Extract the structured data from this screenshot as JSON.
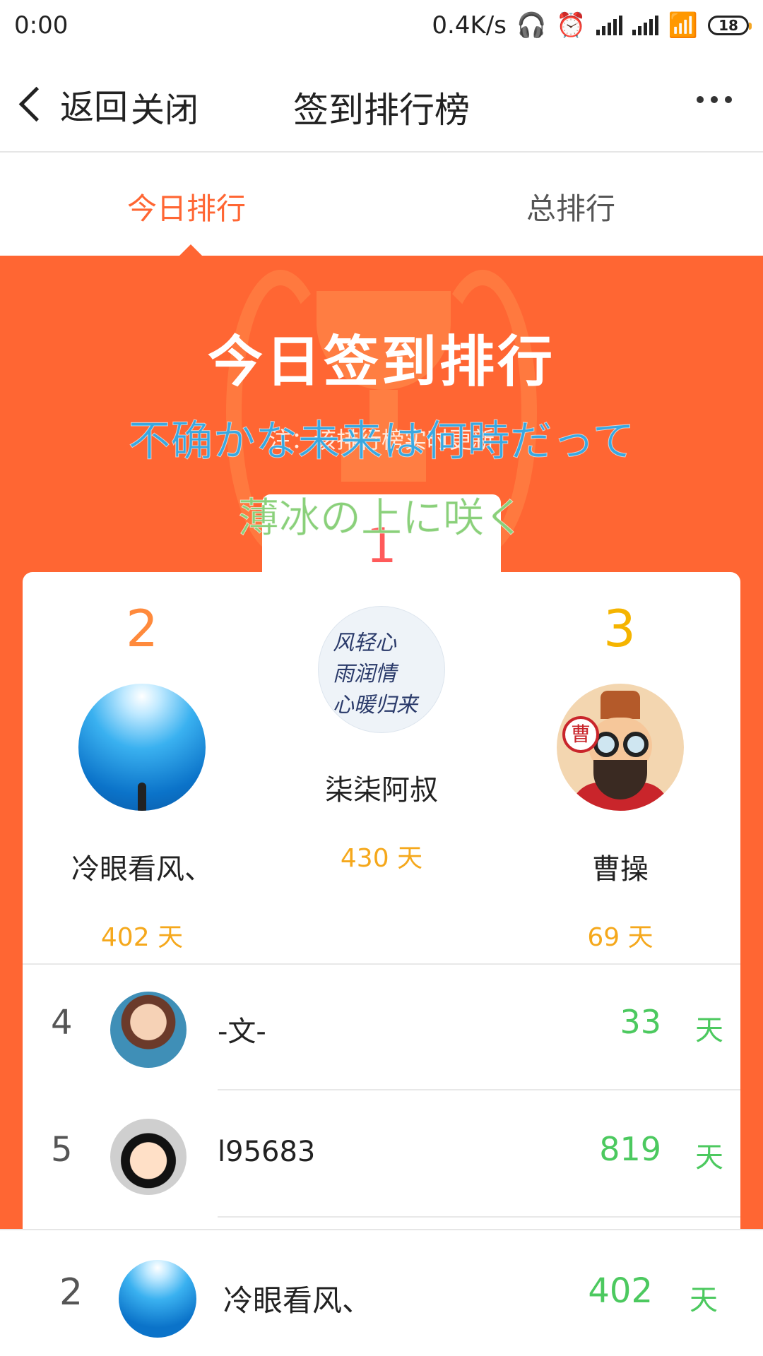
{
  "status": {
    "time": "0:00",
    "speed": "0.4K/s",
    "battery": "18",
    "icons": [
      "headphones-icon",
      "alarm-icon",
      "signal-icon",
      "signal-icon",
      "wifi-icon",
      "battery-icon"
    ]
  },
  "nav": {
    "back_label": "返回",
    "close_label": "关闭",
    "title": "签到排行榜",
    "more_icon": "more-dots-icon"
  },
  "tabs": [
    {
      "label": "今日排行",
      "active": true
    },
    {
      "label": "总排行",
      "active": false
    }
  ],
  "hero": {
    "title": "今日签到排行",
    "subtitle": "注：该排行榜实时更新"
  },
  "lyrics": {
    "line1": "不确かな未来は何時だって",
    "line2": "薄冰の上に咲く"
  },
  "podium": {
    "first": {
      "rank": "1",
      "name": "柒柒阿叔",
      "days": "430 天",
      "avatar_text": [
        "风轻心",
        "雨润情",
        "心暖归来"
      ]
    },
    "second": {
      "rank": "2",
      "name": "冷眼看风、",
      "days": "402 天"
    },
    "third": {
      "rank": "3",
      "name": "曹操",
      "days": "69 天",
      "badge": "曹"
    }
  },
  "list": [
    {
      "rank": "4",
      "name": "-文-",
      "days": "33",
      "unit": "天"
    },
    {
      "rank": "5",
      "name": "l95683",
      "days": "819",
      "unit": "天"
    }
  ],
  "me": {
    "rank": "2",
    "name": "冷眼看风、",
    "days": "402",
    "unit": "天"
  },
  "colors": {
    "accent": "#ff6633",
    "green": "#4cc95f",
    "gold": "#f5a81c"
  }
}
